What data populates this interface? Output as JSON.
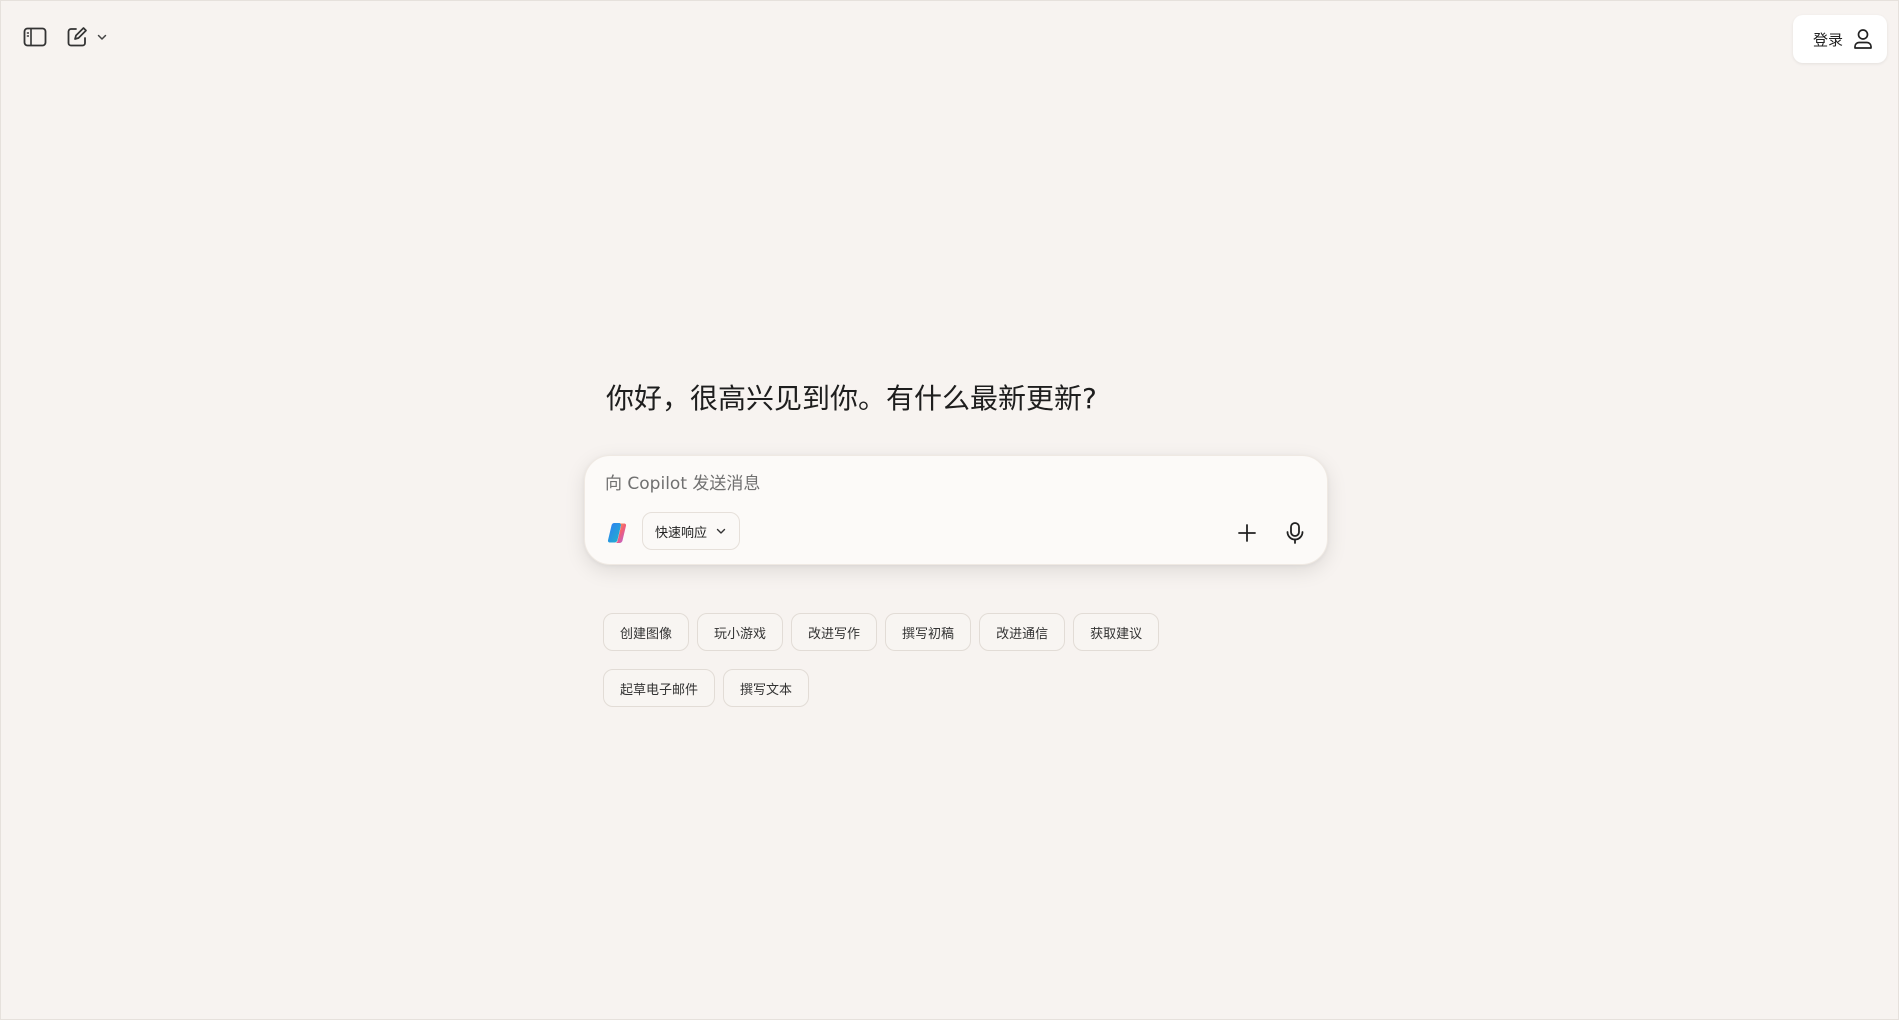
{
  "header": {
    "sidebar_toggle_icon": "sidebar-icon",
    "new_chat_icon": "compose-icon",
    "new_chat_menu_icon": "chevron-down-icon",
    "login_label": "登录",
    "login_icon": "user-icon"
  },
  "main": {
    "greeting": "你好，很高兴见到你。有什么最新更新?"
  },
  "composer": {
    "placeholder": "向 Copilot 发送消息",
    "value": "",
    "logo_icon": "copilot-logo-icon",
    "mode_label": "快速响应",
    "mode_icon": "chevron-down-icon",
    "add_icon": "plus-icon",
    "voice_icon": "microphone-icon"
  },
  "suggestions": [
    "创建图像",
    "玩小游戏",
    "改进写作",
    "撰写初稿",
    "改进通信",
    "获取建议",
    "起草电子邮件",
    "撰写文本"
  ],
  "colors": {
    "background": "#f7f3f0",
    "surface": "#fcfaf8",
    "text": "#1f1f1f"
  }
}
